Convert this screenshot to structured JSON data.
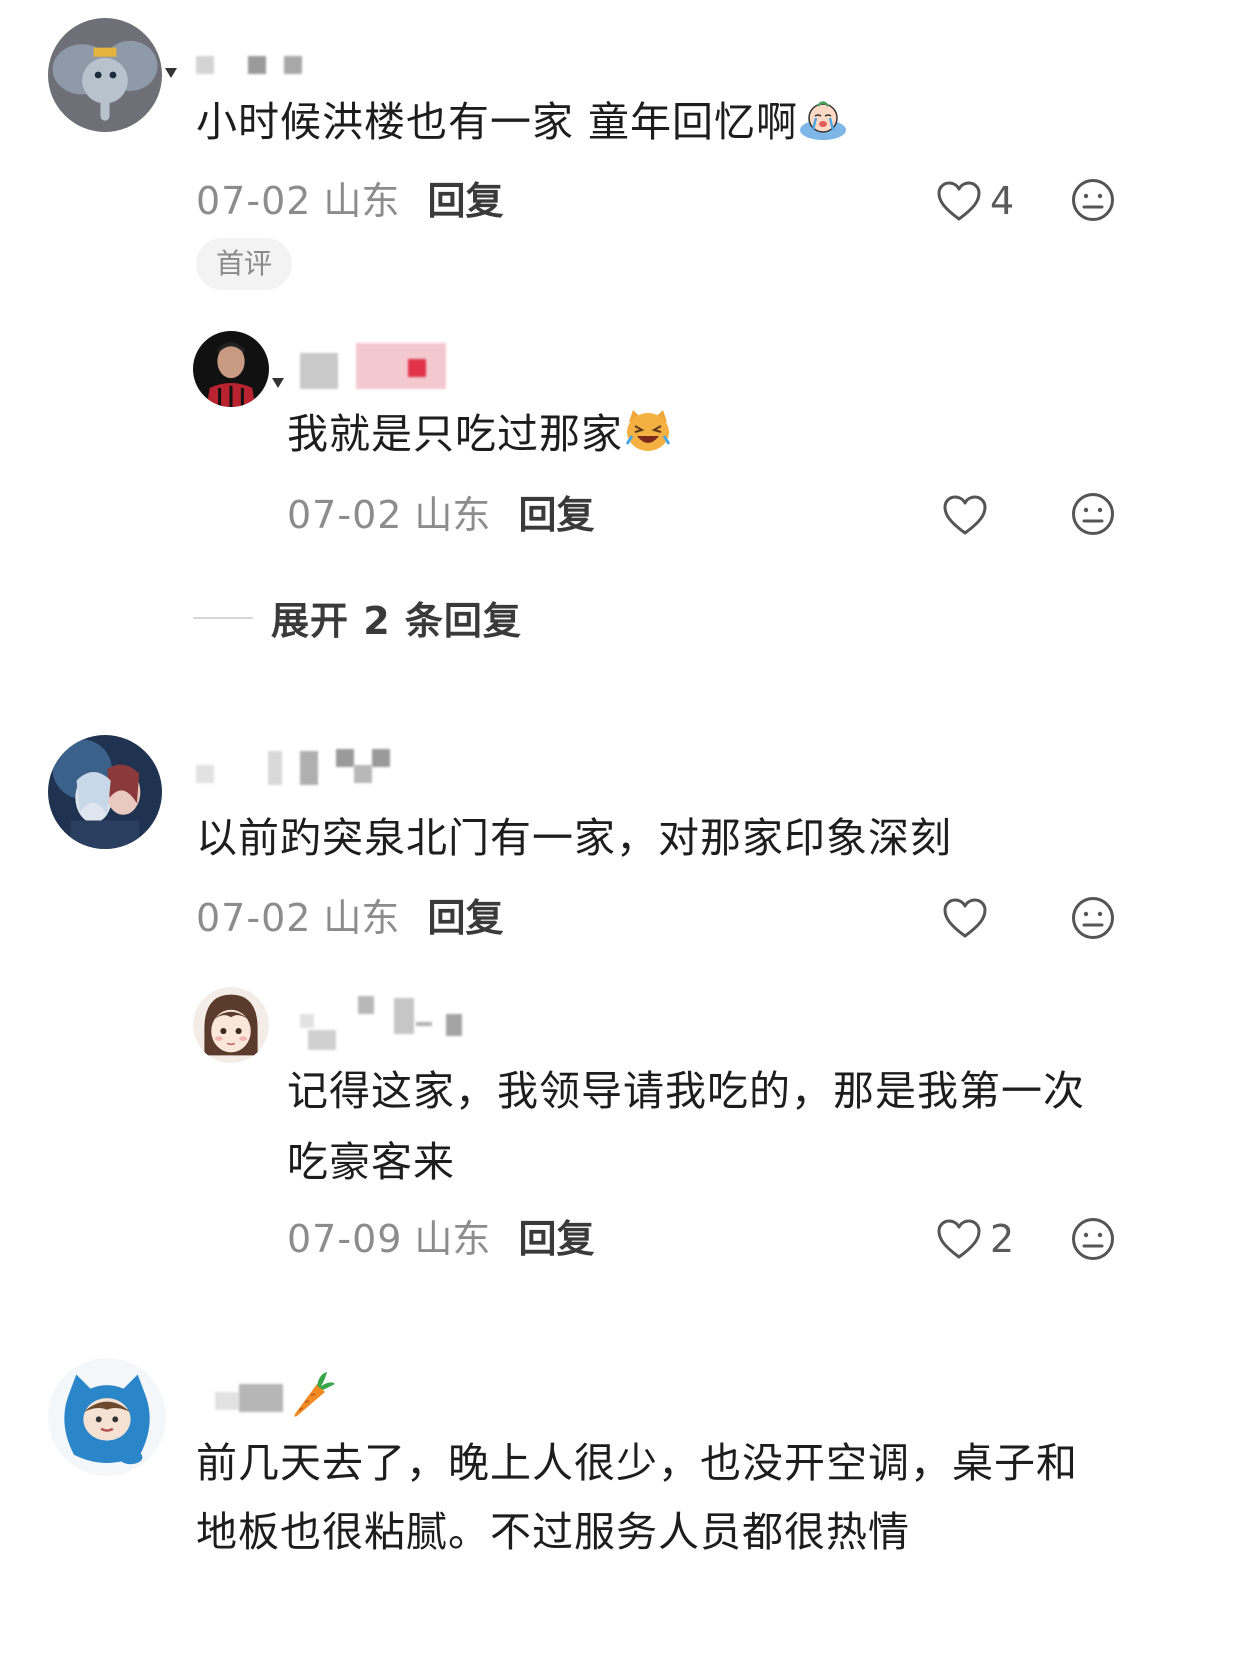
{
  "comments": [
    {
      "text": "小时候洪楼也有一家 童年回忆啊",
      "emoji": "crying-face-emoji",
      "date": "07-02",
      "location": "山东",
      "reply_label": "回复",
      "likes": "4",
      "badge": "首评",
      "replies": [
        {
          "text": "我就是只吃过那家",
          "emoji": "laughing-cat-emoji",
          "date": "07-02",
          "location": "山东",
          "reply_label": "回复",
          "likes": ""
        }
      ],
      "expand_label": "展开 2 条回复"
    },
    {
      "text": "以前趵突泉北门有一家，对那家印象深刻",
      "date": "07-02",
      "location": "山东",
      "reply_label": "回复",
      "likes": "",
      "replies": [
        {
          "text_line1": "记得这家，我领导请我吃的，那是我第一次",
          "text_line2": "吃豪客来",
          "date": "07-09",
          "location": "山东",
          "reply_label": "回复",
          "likes": "2"
        }
      ]
    },
    {
      "name_emoji": "carrot-emoji",
      "text_line1": "前几天去了，晚上人很少，也没开空调，桌子和",
      "text_line2": "地板也很粘腻。不过服务人员都很热情"
    }
  ],
  "colors": {
    "text": "#1d1d1d",
    "meta": "#8c8c8c",
    "reply": "#3a3a3a",
    "badge_bg": "#f3f3f3"
  }
}
